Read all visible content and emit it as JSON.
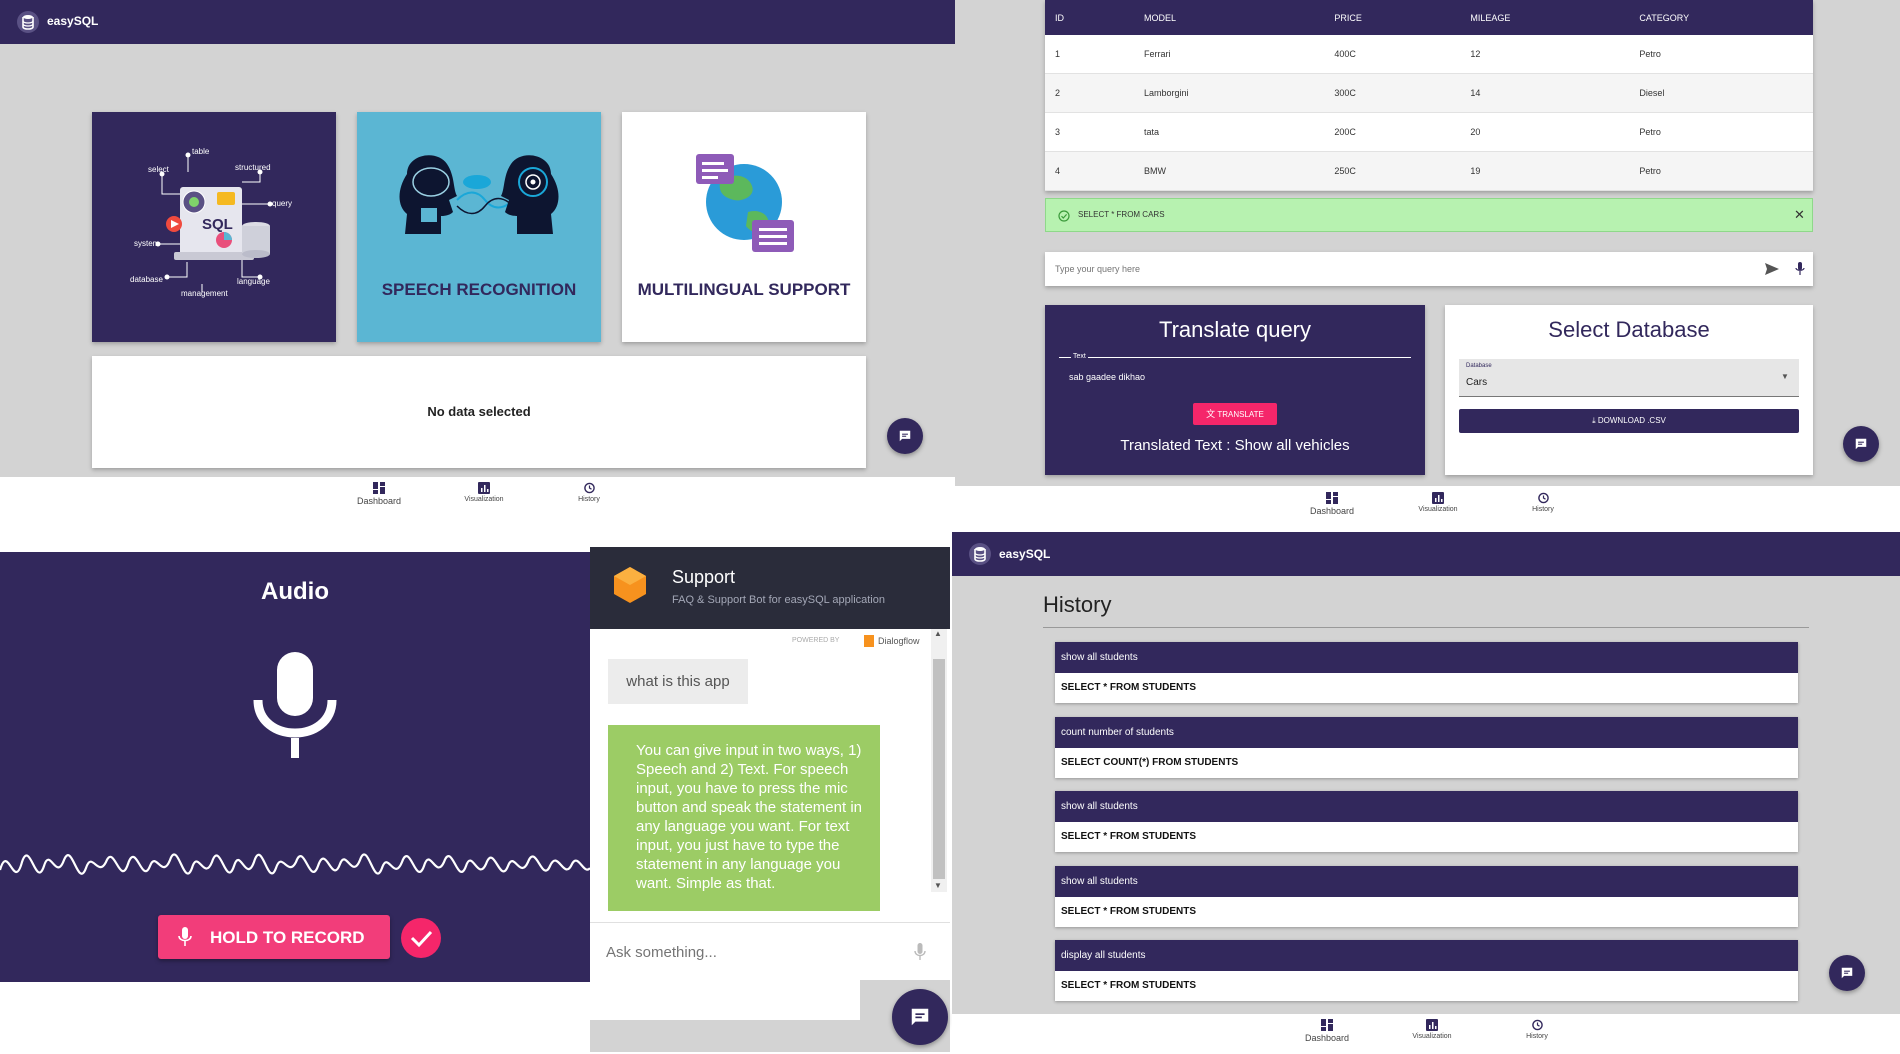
{
  "app": {
    "name": "easySQL"
  },
  "dashboard": {
    "cards": [
      {
        "label": ""
      },
      {
        "label": "SPEECH RECOGNITION"
      },
      {
        "label": "MULTILINGUAL SUPPORT"
      }
    ],
    "illustration_words": [
      "table",
      "select",
      "structured",
      "query",
      "SQL",
      "system",
      "database",
      "language",
      "management"
    ],
    "empty_text": "No data selected"
  },
  "bottom_nav": {
    "items": [
      {
        "label": "Dashboard",
        "icon": "dashboard-icon"
      },
      {
        "label": "Visualization",
        "icon": "chart-icon"
      },
      {
        "label": "History",
        "icon": "history-icon"
      }
    ]
  },
  "cars_table": {
    "headers": [
      "ID",
      "MODEL",
      "PRICE",
      "MILEAGE",
      "CATEGORY"
    ],
    "rows": [
      [
        "1",
        "Ferrari",
        "400C",
        "12",
        "Petro"
      ],
      [
        "2",
        "Lamborgini",
        "300C",
        "14",
        "Diesel"
      ],
      [
        "3",
        "tata",
        "200C",
        "20",
        "Petro"
      ],
      [
        "4",
        "BMW",
        "250C",
        "19",
        "Petro"
      ]
    ]
  },
  "query_alert": {
    "text": "SELECT * FROM CARS"
  },
  "query_input": {
    "placeholder": "Type your query here"
  },
  "translate": {
    "title": "Translate query",
    "field_label": "Text",
    "field_value": "sab gaadee dikhao",
    "button": "TRANSLATE",
    "result": "Translated Text : Show all vehicles"
  },
  "select_db": {
    "title": "Select Database",
    "field_label": "Database",
    "value": "Cars",
    "download": "DOWNLOAD .CSV"
  },
  "audio": {
    "title": "Audio",
    "record_button": "HOLD TO RECORD"
  },
  "support": {
    "title": "Support",
    "subtitle": "FAQ & Support Bot for easySQL application",
    "powered_by": "POWERED BY",
    "powered_brand": "Dialogflow",
    "user_msg": "what is this app",
    "bot_msg": "You can give input in two ways, 1) Speech and 2) Text. For speech input, you have to press the mic button and speak the statement in any language you want. For text input, you just have to type the statement in any language you want. Simple as that.",
    "input_placeholder": "Ask something..."
  },
  "history": {
    "title": "History",
    "items": [
      {
        "query": "show all students",
        "sql": "SELECT * FROM STUDENTS"
      },
      {
        "query": "count number of students",
        "sql": "SELECT COUNT(*) FROM STUDENTS"
      },
      {
        "query": "show all students",
        "sql": "SELECT * FROM STUDENTS"
      },
      {
        "query": "show all students",
        "sql": "SELECT * FROM STUDENTS"
      },
      {
        "query": "display all students",
        "sql": "SELECT * FROM STUDENTS"
      }
    ]
  },
  "colors": {
    "primary": "#32285c",
    "card_blue": "#5bb6d3",
    "alert_green": "#b7f2b0",
    "accent_pink": "#f5266a",
    "chat_green": "#9ccc65",
    "background_grey": "#d3d3d3"
  }
}
